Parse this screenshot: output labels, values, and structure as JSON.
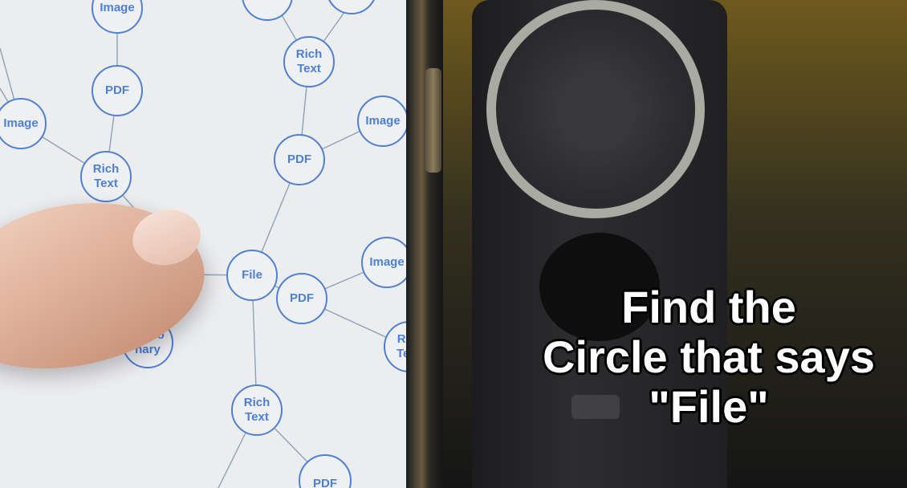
{
  "screen": {
    "accent_color": "#4d80d8",
    "nodes": [
      {
        "id": "n1",
        "label": "Image"
      },
      {
        "id": "n2",
        "label": "Rich\nText"
      },
      {
        "id": "n3",
        "label": "PDF"
      },
      {
        "id": "n4",
        "label": "Image"
      },
      {
        "id": "n5",
        "label": "Image"
      },
      {
        "id": "n6",
        "label": "PDF"
      },
      {
        "id": "n7",
        "label": "Rich\nText"
      },
      {
        "id": "n8",
        "label": "File"
      },
      {
        "id": "n9",
        "label": "Image"
      },
      {
        "id": "n10",
        "label": "PDF"
      },
      {
        "id": "n11",
        "label": "Dictio\nnary"
      },
      {
        "id": "n12",
        "label": "Ri\nTe"
      },
      {
        "id": "n13",
        "label": "Rich\nText"
      },
      {
        "id": "n14",
        "label": "PDF"
      }
    ]
  },
  "overlay": {
    "caption": "Find the\nCircle that says\n\"File\""
  }
}
